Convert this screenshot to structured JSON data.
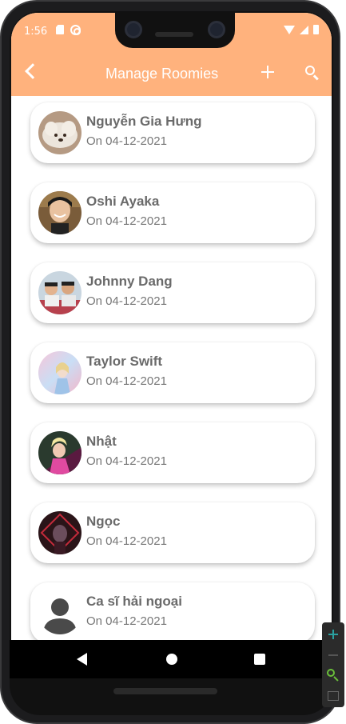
{
  "status_bar": {
    "time": "1:56"
  },
  "app_bar": {
    "title": "Manage Roomies"
  },
  "roomies": [
    {
      "name": "Nguyễn Gia Hưng",
      "date": "On 04-12-2021",
      "avatar": "puppy-photo"
    },
    {
      "name": "Oshi Ayaka",
      "date": "On 04-12-2021",
      "avatar": "person-photo"
    },
    {
      "name": "Johnny Dang",
      "date": "On 04-12-2021",
      "avatar": "group-photo"
    },
    {
      "name": "Taylor Swift",
      "date": "On 04-12-2021",
      "avatar": "album-art"
    },
    {
      "name": "Nhật",
      "date": "On 04-12-2021",
      "avatar": "album-art"
    },
    {
      "name": "Ngọc",
      "date": "On 04-12-2021",
      "avatar": "album-art"
    },
    {
      "name": "Ca sĩ hải ngoại",
      "date": "On 04-12-2021",
      "avatar": "default-person-icon"
    }
  ],
  "colors": {
    "accent": "#ffb27d",
    "text_primary": "#6a6a6a",
    "text_secondary": "#777777"
  }
}
